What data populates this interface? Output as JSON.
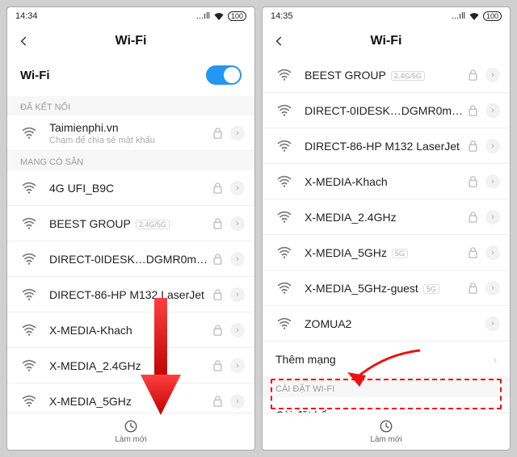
{
  "status": {
    "time_left": "14:34",
    "time_right": "14:35",
    "battery": "100"
  },
  "header": {
    "title": "Wi-Fi"
  },
  "left": {
    "toggle_label": "Wi-Fi",
    "section_connected": "ĐÃ KẾT NỐI",
    "connected": {
      "ssid": "Taimienphi.vn",
      "hint": "Chạm để chia sẻ mật khẩu"
    },
    "section_available": "MẠNG CÓ SẴN",
    "networks": [
      {
        "ssid": "4G UFI_B9C",
        "locked": true
      },
      {
        "ssid": "BEEST GROUP",
        "badge": "2.4G/5G",
        "locked": true
      },
      {
        "ssid": "DIRECT-0IDESK…DGMR0msUW",
        "locked": true
      },
      {
        "ssid": "DIRECT-86-HP M132 LaserJet",
        "locked": true
      },
      {
        "ssid": "X-MEDIA-Khach",
        "locked": true
      },
      {
        "ssid": "X-MEDIA_2.4GHz",
        "locked": true
      },
      {
        "ssid": "X-MEDIA_5GHz",
        "locked": true
      }
    ],
    "refresh": "Làm mới"
  },
  "right": {
    "networks": [
      {
        "ssid": "BEEST GROUP",
        "badge": "2.4G/5G",
        "locked": true
      },
      {
        "ssid": "DIRECT-0IDESK…DGMR0msUW",
        "locked": true
      },
      {
        "ssid": "DIRECT-86-HP M132 LaserJet",
        "locked": true
      },
      {
        "ssid": "X-MEDIA-Khach",
        "locked": true
      },
      {
        "ssid": "X-MEDIA_2.4GHz",
        "locked": true
      },
      {
        "ssid": "X-MEDIA_5GHz",
        "badge": "5G",
        "locked": true
      },
      {
        "ssid": "X-MEDIA_5GHz-guest",
        "badge": "5G",
        "locked": true
      },
      {
        "ssid": "ZOMUA2",
        "locked": false
      }
    ],
    "add_network": "Thêm mạng",
    "section_settings": "CÀI ĐẶT WI-FI",
    "advanced": "Cài đặt bổ sung",
    "refresh": "Làm mới"
  }
}
